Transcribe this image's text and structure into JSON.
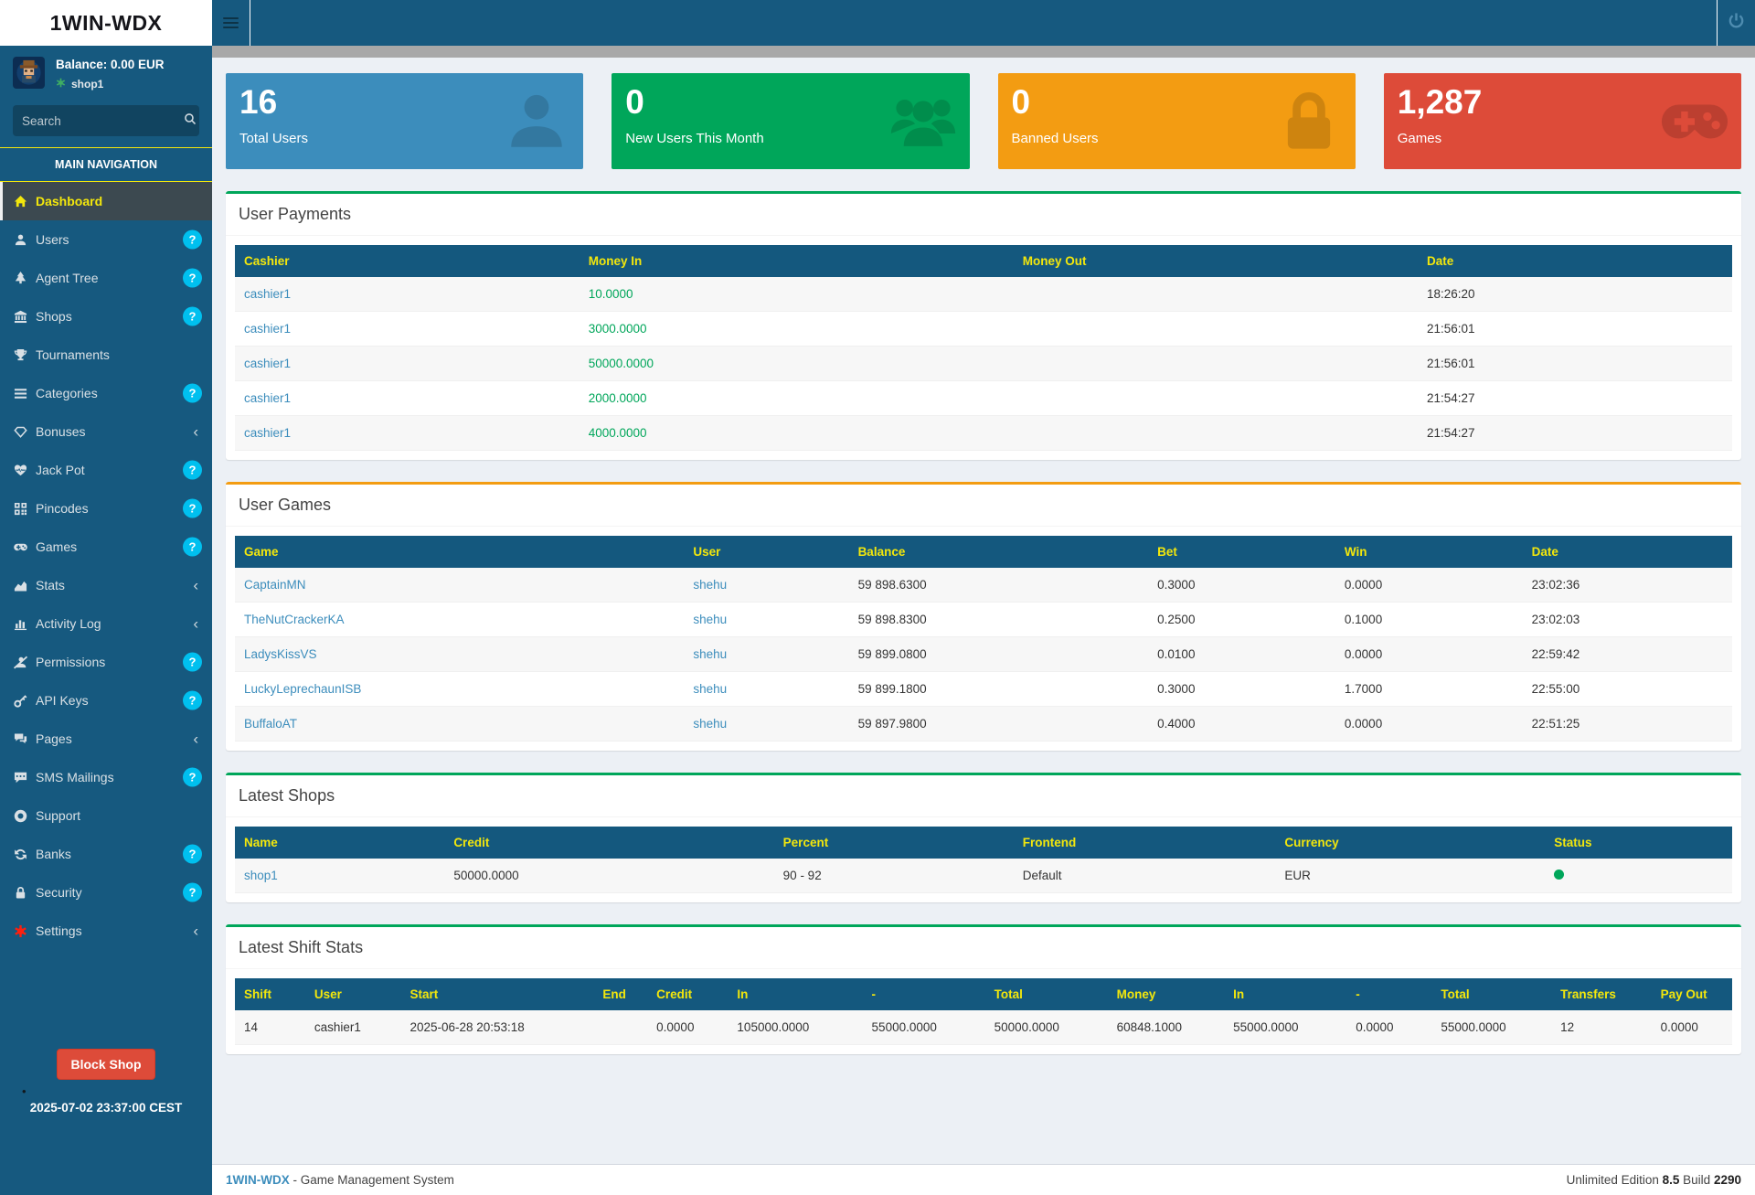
{
  "header": {
    "logo": "1WIN-WDX"
  },
  "sidebar": {
    "balance": "Balance: 0.00 EUR",
    "shop_name": "shop1",
    "search_placeholder": "Search",
    "nav_header": "MAIN NAVIGATION",
    "menu": [
      {
        "label": "Dashboard",
        "icon": "home",
        "badge": "none",
        "active": true
      },
      {
        "label": "Users",
        "icon": "user",
        "badge": "help"
      },
      {
        "label": "Agent Tree",
        "icon": "tree",
        "badge": "help"
      },
      {
        "label": "Shops",
        "icon": "bank",
        "badge": "help"
      },
      {
        "label": "Tournaments",
        "icon": "trophy",
        "badge": "none"
      },
      {
        "label": "Categories",
        "icon": "list",
        "badge": "help"
      },
      {
        "label": "Bonuses",
        "icon": "diamond",
        "badge": "chevron"
      },
      {
        "label": "Jack Pot",
        "icon": "heartbeat",
        "badge": "help"
      },
      {
        "label": "Pincodes",
        "icon": "qrcode",
        "badge": "help"
      },
      {
        "label": "Games",
        "icon": "gamepad",
        "badge": "help"
      },
      {
        "label": "Stats",
        "icon": "area-chart",
        "badge": "chevron"
      },
      {
        "label": "Activity Log",
        "icon": "bar-chart",
        "badge": "chevron"
      },
      {
        "label": "Permissions",
        "icon": "user-slash",
        "badge": "help"
      },
      {
        "label": "API Keys",
        "icon": "key",
        "badge": "help"
      },
      {
        "label": "Pages",
        "icon": "comments",
        "badge": "chevron"
      },
      {
        "label": "SMS Mailings",
        "icon": "comment-dots",
        "badge": "help"
      },
      {
        "label": "Support",
        "icon": "life-ring",
        "badge": "none"
      },
      {
        "label": "Banks",
        "icon": "refresh",
        "badge": "help"
      },
      {
        "label": "Security",
        "icon": "lock",
        "badge": "help"
      },
      {
        "label": "Settings",
        "icon": "gear",
        "badge": "chevron",
        "icon_color": "#ff1f0d"
      }
    ],
    "block_shop_label": "Block Shop",
    "timestamp": "2025-07-02 23:37:00 CEST"
  },
  "stats": [
    {
      "value": "16",
      "label": "Total Users",
      "color": "#3c8dbc",
      "icon": "user"
    },
    {
      "value": "0",
      "label": "New Users This Month",
      "color": "#00a65a",
      "icon": "group"
    },
    {
      "value": "0",
      "label": "Banned Users",
      "color": "#f39c12",
      "icon": "lock"
    },
    {
      "value": "1,287",
      "label": "Games",
      "color": "#dd4b39",
      "icon": "gamepad"
    }
  ],
  "sections": {
    "user_payments": {
      "title": "User Payments",
      "accent": "#00a65a",
      "columns": [
        "Cashier",
        "Money In",
        "Money Out",
        "Date"
      ],
      "rows": [
        [
          "cashier1",
          "10.0000",
          "",
          "18:26:20"
        ],
        [
          "cashier1",
          "3000.0000",
          "",
          "21:56:01"
        ],
        [
          "cashier1",
          "50000.0000",
          "",
          "21:56:01"
        ],
        [
          "cashier1",
          "2000.0000",
          "",
          "21:54:27"
        ],
        [
          "cashier1",
          "4000.0000",
          "",
          "21:54:27"
        ]
      ]
    },
    "user_games": {
      "title": "User Games",
      "accent": "#f39c12",
      "columns": [
        "Game",
        "User",
        "Balance",
        "Bet",
        "Win",
        "Date"
      ],
      "rows": [
        [
          "CaptainMN",
          "shehu",
          "59 898.6300",
          "0.3000",
          "0.0000",
          "23:02:36"
        ],
        [
          "TheNutCrackerKA",
          "shehu",
          "59 898.8300",
          "0.2500",
          "0.1000",
          "23:02:03"
        ],
        [
          "LadysKissVS",
          "shehu",
          "59 899.0800",
          "0.0100",
          "0.0000",
          "22:59:42"
        ],
        [
          "LuckyLeprechaunISB",
          "shehu",
          "59 899.1800",
          "0.3000",
          "1.7000",
          "22:55:00"
        ],
        [
          "BuffaloAT",
          "shehu",
          "59 897.9800",
          "0.4000",
          "0.0000",
          "22:51:25"
        ]
      ]
    },
    "latest_shops": {
      "title": "Latest Shops",
      "accent": "#00a65a",
      "columns": [
        "Name",
        "Credit",
        "Percent",
        "Frontend",
        "Currency",
        "Status"
      ],
      "rows": [
        [
          "shop1",
          "50000.0000",
          "90 - 92",
          "Default",
          "EUR",
          "#00a65a"
        ]
      ]
    },
    "shift_stats": {
      "title": "Latest Shift Stats",
      "accent": "#00a65a",
      "columns": [
        "Shift",
        "User",
        "Start",
        "End",
        "Credit",
        "In",
        "-",
        "Total",
        "Money",
        "In",
        "-",
        "Total",
        "Transfers",
        "Pay Out"
      ],
      "rows": [
        [
          "14",
          "cashier1",
          "2025-06-28 20:53:18",
          "",
          "0.0000",
          "105000.0000",
          "55000.0000",
          "50000.0000",
          "60848.1000",
          "55000.0000",
          "0.0000",
          "55000.0000",
          "12",
          "0.0000"
        ]
      ]
    }
  },
  "footer": {
    "brand": "1WIN-WDX",
    "left_rest": " - Game Management System",
    "right_prefix": "Unlimited Edition ",
    "version": "8.5",
    "build_label": " Build ",
    "build": "2290"
  },
  "colors": {
    "sidebar": "#16597f",
    "table_header": "#14587e",
    "yellow": "#f3e70c",
    "badge_aqua": "#00c0ef",
    "link": "#3c8dbc",
    "money_green": "#00a65a",
    "status_ok": "#00a65a",
    "block_shop_red": "#dd4b39"
  }
}
